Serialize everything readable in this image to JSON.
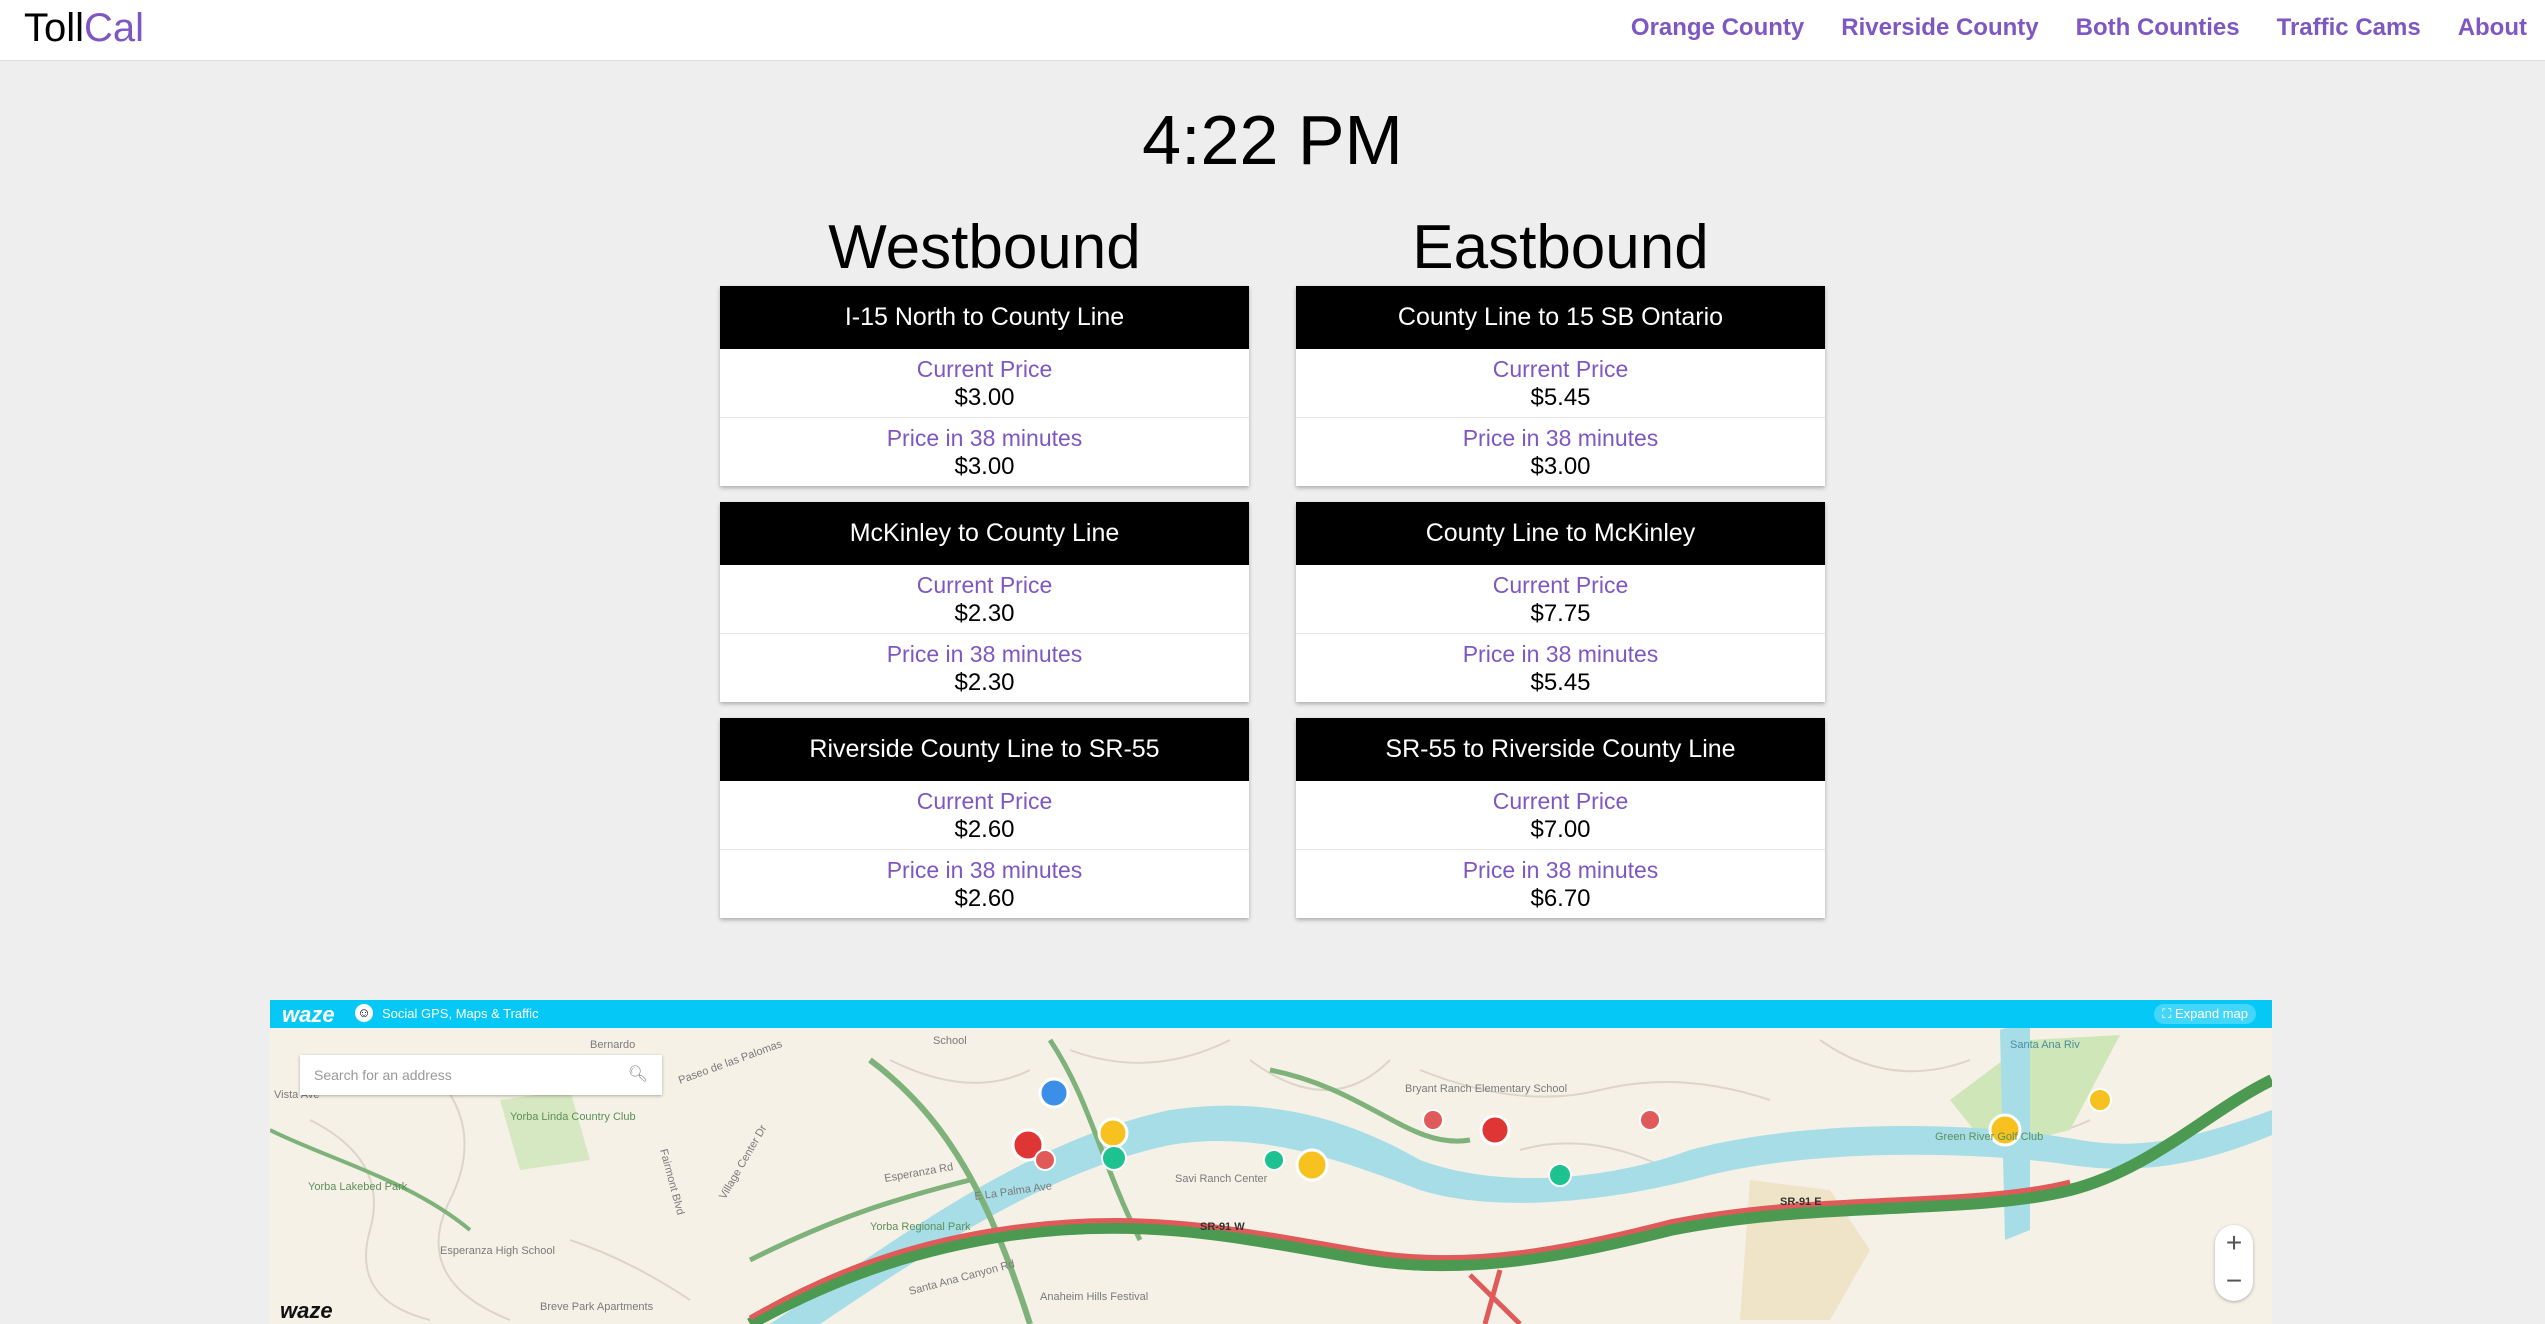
{
  "brand": {
    "part1": "Toll",
    "part2": "Cal"
  },
  "nav": {
    "orange": "Orange County",
    "riverside": "Riverside County",
    "both": "Both Counties",
    "cams": "Traffic Cams",
    "about": "About"
  },
  "clock": "4:22 PM",
  "westbound": {
    "heading": "Westbound",
    "cards": [
      {
        "route": "I-15 North to County Line",
        "current_label": "Current Price",
        "current": "$3.00",
        "future_label": "Price in 38 minutes",
        "future": "$3.00"
      },
      {
        "route": "McKinley to County Line",
        "current_label": "Current Price",
        "current": "$2.30",
        "future_label": "Price in 38 minutes",
        "future": "$2.30"
      },
      {
        "route": "Riverside County Line to SR-55",
        "current_label": "Current Price",
        "current": "$2.60",
        "future_label": "Price in 38 minutes",
        "future": "$2.60"
      }
    ]
  },
  "eastbound": {
    "heading": "Eastbound",
    "cards": [
      {
        "route": "County Line to 15 SB Ontario",
        "current_label": "Current Price",
        "current": "$5.45",
        "future_label": "Price in 38 minutes",
        "future": "$3.00"
      },
      {
        "route": "County Line to McKinley",
        "current_label": "Current Price",
        "current": "$7.75",
        "future_label": "Price in 38 minutes",
        "future": "$5.45"
      },
      {
        "route": "SR-55 to Riverside County Line",
        "current_label": "Current Price",
        "current": "$7.00",
        "future_label": "Price in 38 minutes",
        "future": "$6.70"
      }
    ]
  },
  "map": {
    "logo": "waze",
    "tagline": "Social GPS, Maps & Traffic",
    "expand": "Expand map",
    "search_placeholder": "Search for an address",
    "zoom_in": "+",
    "zoom_out": "−",
    "labels": {
      "vista": "Vista Ave",
      "bernardo": "Bernardo",
      "paseo": "Paseo de las Palomas",
      "school": "School",
      "yorba_linda_cc": "Yorba Linda Country Club",
      "yorba_lakebed": "Yorba Lakebed Park",
      "esperanza_hs": "Esperanza High School",
      "breve": "Breve Park Apartments",
      "fairmont": "Fairmont Blvd",
      "village": "Village Center Dr",
      "esperanza_rd": "Esperanza Rd",
      "yorba_regional": "Yorba Regional Park",
      "la_palma": "E La Palma Ave",
      "anaheim_fest": "Anaheim Hills Festival",
      "santa_ana_cyn": "Santa Ana Canyon Rd",
      "savi": "Savi Ranch Center",
      "bryant": "Bryant Ranch Elementary School",
      "green_river": "Green River Golf Club",
      "santa_ana_riv": "Santa Ana Riv",
      "sr91w": "SR-91 W",
      "sr91e": "SR-91 E"
    },
    "colors": {
      "bar": "#05c8f7",
      "river": "#a6dde6",
      "traffic": "#e05a5a",
      "road": "#4c9a52"
    }
  }
}
